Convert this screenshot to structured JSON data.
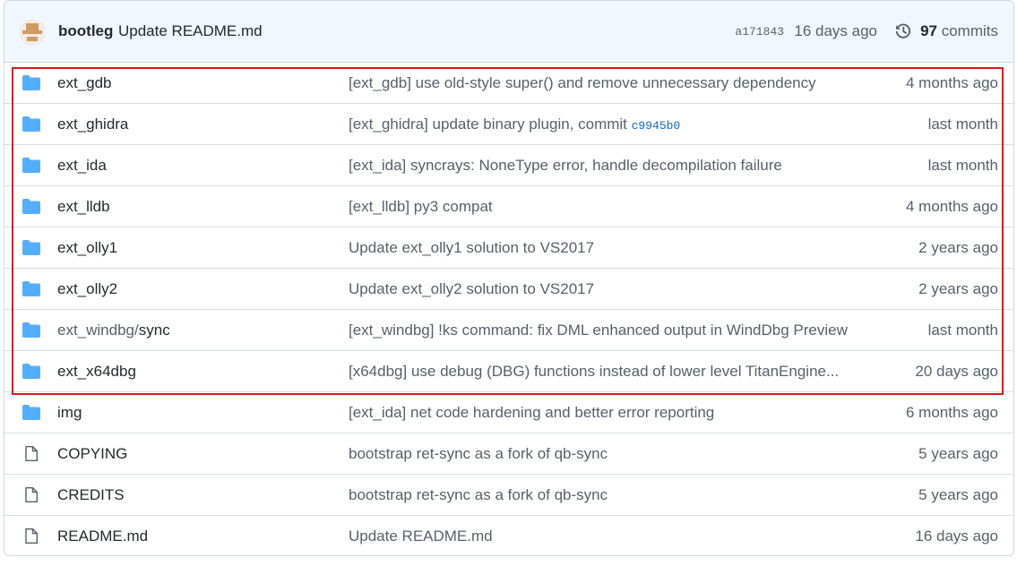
{
  "header": {
    "author": "bootleg",
    "message": "Update README.md",
    "sha": "a171843",
    "date": "16 days ago",
    "commit_count": "97",
    "commits_label": "commits",
    "history_icon": "history-icon"
  },
  "colors": {
    "folder": "#54aeff",
    "highlight": "#e0161e",
    "link": "#0969da"
  },
  "files": [
    {
      "type": "folder",
      "name": "ext_gdb",
      "message": "[ext_gdb] use old-style super() and remove unnecessary dependency",
      "age": "4 months ago"
    },
    {
      "type": "folder",
      "name": "ext_ghidra",
      "message": "[ext_ghidra] update binary plugin, commit ",
      "sha": "c9945b0",
      "age": "last month"
    },
    {
      "type": "folder",
      "name": "ext_ida",
      "message": "[ext_ida] syncrays: NoneType error, handle decompilation failure",
      "age": "last month"
    },
    {
      "type": "folder",
      "name": "ext_lldb",
      "message": "[ext_lldb] py3 compat",
      "age": "4 months ago"
    },
    {
      "type": "folder",
      "name": "ext_olly1",
      "message": "Update ext_olly1 solution to VS2017",
      "age": "2 years ago"
    },
    {
      "type": "folder",
      "name": "ext_olly2",
      "message": "Update ext_olly2 solution to VS2017",
      "age": "2 years ago"
    },
    {
      "type": "folder",
      "prefix": "ext_windbg/",
      "name": "sync",
      "message": "[ext_windbg] !ks command: fix DML enhanced output in WindDbg Preview",
      "age": "last month"
    },
    {
      "type": "folder",
      "name": "ext_x64dbg",
      "message": "[x64dbg] use debug (DBG) functions instead of lower level TitanEngine...",
      "age": "20 days ago"
    },
    {
      "type": "folder",
      "name": "img",
      "message": "[ext_ida] net code hardening and better error reporting",
      "age": "6 months ago"
    },
    {
      "type": "file",
      "name": "COPYING",
      "message": "bootstrap ret-sync as a fork of qb-sync",
      "age": "5 years ago"
    },
    {
      "type": "file",
      "name": "CREDITS",
      "message": "bootstrap ret-sync as a fork of qb-sync",
      "age": "5 years ago"
    },
    {
      "type": "file",
      "name": "README.md",
      "message": "Update README.md",
      "age": "16 days ago"
    }
  ]
}
